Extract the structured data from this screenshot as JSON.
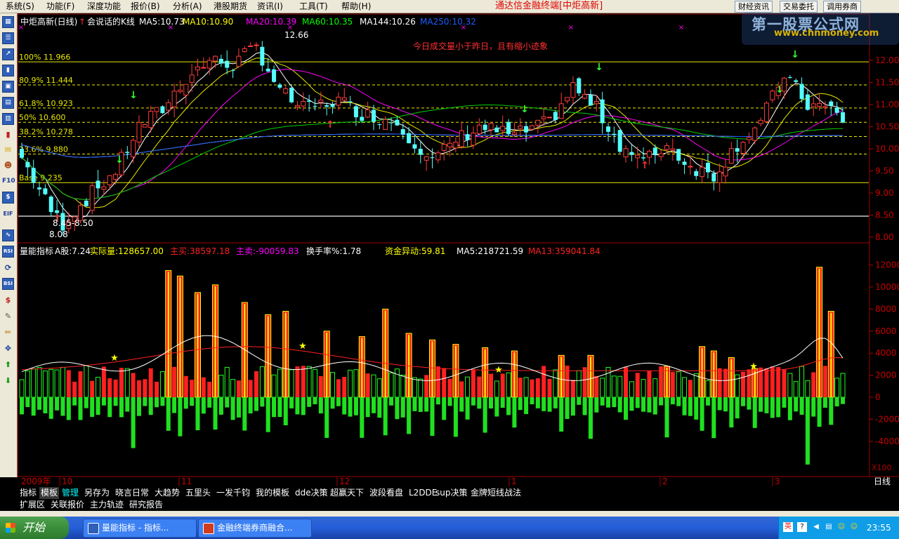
{
  "menu": [
    {
      "label": "系统(S)"
    },
    {
      "label": "功能(F)"
    },
    {
      "label": "深度功能"
    },
    {
      "label": "报价(B)"
    },
    {
      "label": "分析(A)"
    },
    {
      "label": "港股期货"
    },
    {
      "label": "资讯(I)"
    },
    {
      "label": "工具(T)"
    },
    {
      "label": "帮助(H)"
    }
  ],
  "app_title": "通达信金融终端[中炬高新]",
  "top_buttons": [
    "财经资讯",
    "交易委托",
    "调用券商"
  ],
  "watermark": {
    "line1": "第一股票公式网",
    "line2": "www.chnmoney.com"
  },
  "kline_header": {
    "stock": "中炬高新(日线)",
    "indicator": "会说话的K线",
    "items": [
      {
        "text": "MA5:10.73",
        "color": "#ffffff",
        "arrow": "↓"
      },
      {
        "text": "MA10:10.90",
        "color": "#ffff00",
        "arrow": "↑"
      },
      {
        "text": "MA20:10.39",
        "color": "#ff00ff",
        "arrow": "↑"
      },
      {
        "text": "MA60:10.35",
        "color": "#00ff00",
        "arrow": "↓"
      },
      {
        "text": "MA144:10.26",
        "color": "#ffffff",
        "arrow": "↓"
      },
      {
        "text": "MA250:10.32",
        "color": "#1e5cff",
        "arrow": "↑"
      }
    ]
  },
  "annotation": "今日成交量小于昨日，且有缩小迹象",
  "fib_levels": [
    {
      "label": "100% 11.966",
      "price": 11.966
    },
    {
      "label": "80.9% 11.444",
      "price": 11.444
    },
    {
      "label": "61.8% 10.923",
      "price": 10.923
    },
    {
      "label": "50% 10.600",
      "price": 10.6
    },
    {
      "label": "38.2% 10.278",
      "price": 10.278
    },
    {
      "label": "23.6% 9.880",
      "price": 9.88
    },
    {
      "label": "Base 9.235",
      "price": 9.235
    }
  ],
  "price_axis": [
    "12.00",
    "11.50",
    "11.00",
    "10.50",
    "10.00",
    "9.50",
    "9.00",
    "8.50",
    "8.00"
  ],
  "price_labels": {
    "high": "12.66",
    "low": "8.08",
    "range": "8.45-8.50"
  },
  "volume_header": {
    "name": "量能指标",
    "items": [
      {
        "text": "A股:7.24",
        "color": "#ffffff",
        "arrow": ""
      },
      {
        "text": "实际量:128657.00",
        "color": "#ffff00",
        "arrow": "↓"
      },
      {
        "text": "主买:38597.18",
        "color": "#ff2020",
        "arrow": "↓"
      },
      {
        "text": "主卖:-90059.83",
        "color": "#ff00ff",
        "arrow": "↑"
      },
      {
        "text": "换手率%:1.78",
        "color": "#ffffff",
        "arrow": "↓"
      },
      {
        "text": "资金异动:59.81",
        "color": "#ffff00",
        "arrow": "↓"
      },
      {
        "text": "MA5:218721.59",
        "color": "#ffffff",
        "arrow": "↓"
      },
      {
        "text": "MA13:359041.84",
        "color": "#ff2020",
        "arrow": "↓"
      }
    ]
  },
  "volume_axis": [
    "12000",
    "10000",
    "8000",
    "6000",
    "4000",
    "2000",
    "0",
    "-2000",
    "-4000"
  ],
  "volume_unit": "X100",
  "date_axis": {
    "year": "2009年",
    "months": [
      "10",
      "11",
      "12",
      "1",
      "2",
      "3"
    ],
    "period": "日线"
  },
  "tabs": [
    "指标",
    "模板",
    "管理",
    "另存为",
    "晓言日常",
    "大趋势",
    "五里头",
    "一发千钧",
    "我的模板",
    "dde决策",
    "超赢天下",
    "波段看盘",
    "L2DDE",
    "sup决策",
    "金牌短线战法"
  ],
  "tabs2": [
    "扩展区",
    "关联报价",
    "主力轨迹",
    "研究报告"
  ],
  "taskbar": {
    "start": "开始",
    "windows": [
      "量能指标 - 指标...",
      "金融终端券商融合..."
    ],
    "clock": "23:55"
  },
  "left_toolbar": [
    "grid",
    "list",
    "chart",
    "bars",
    "window",
    "table",
    "table2",
    "candle",
    "mail",
    "people",
    "F10",
    "$",
    "EIF",
    "wave",
    "RSI",
    "refresh",
    "BSI",
    "S",
    "wrench",
    "pencil",
    "move",
    "up",
    "down"
  ]
}
